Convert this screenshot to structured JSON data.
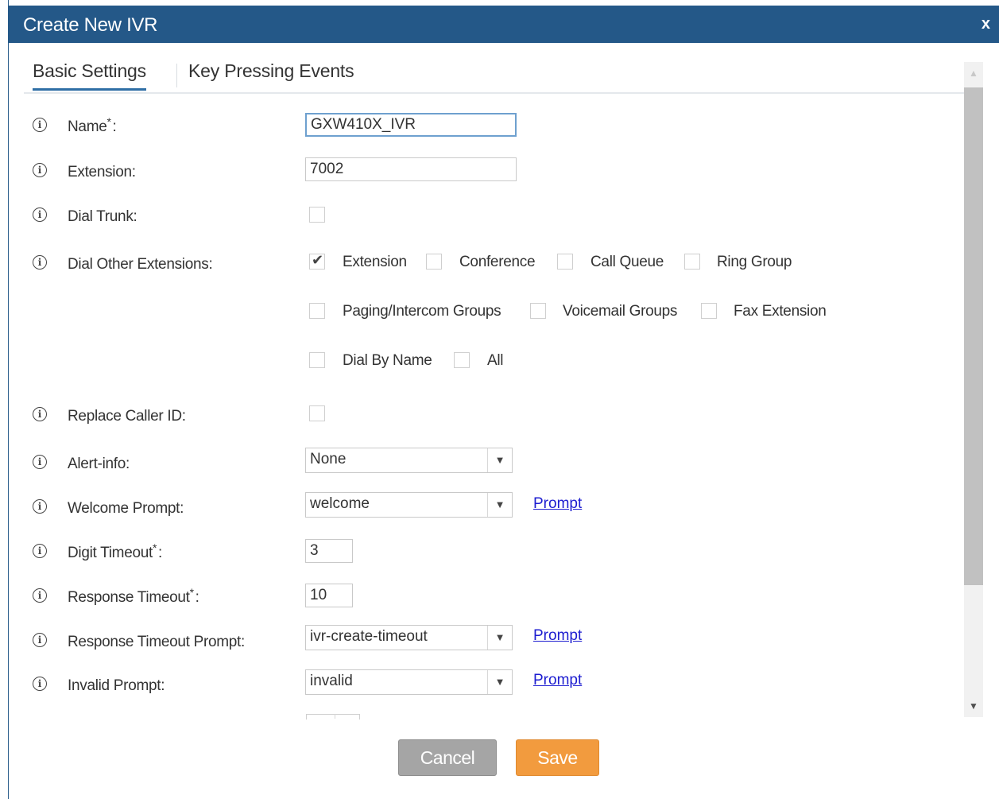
{
  "dialog": {
    "title": "Create New IVR",
    "close": "x"
  },
  "tabs": [
    "Basic Settings",
    "Key Pressing Events"
  ],
  "fields": {
    "name": {
      "label": "Name",
      "required": "*",
      "suffix": ":",
      "value": "GXW410X_IVR"
    },
    "extension": {
      "label": "Extension:",
      "value": "7002"
    },
    "dial_trunk": {
      "label": "Dial Trunk:",
      "checked": false
    },
    "dial_other_extensions": {
      "label": "Dial Other Extensions:",
      "options": [
        {
          "label": "Extension",
          "checked": true
        },
        {
          "label": "Conference",
          "checked": false
        },
        {
          "label": "Call Queue",
          "checked": false
        },
        {
          "label": "Ring Group",
          "checked": false
        },
        {
          "label": "Paging/Intercom Groups",
          "checked": false
        },
        {
          "label": "Voicemail Groups",
          "checked": false
        },
        {
          "label": "Fax Extension",
          "checked": false
        },
        {
          "label": "Dial By Name",
          "checked": false
        },
        {
          "label": "All",
          "checked": false
        }
      ]
    },
    "replace_caller_id": {
      "label": "Replace Caller ID:",
      "checked": false
    },
    "alert_info": {
      "label": "Alert-info:",
      "value": "None"
    },
    "welcome_prompt": {
      "label": "Welcome Prompt:",
      "value": "welcome",
      "link": "Prompt"
    },
    "digit_timeout": {
      "label": "Digit Timeout",
      "required": "*",
      "suffix": ":",
      "value": "3"
    },
    "response_timeout": {
      "label": "Response Timeout",
      "required": "*",
      "suffix": ":",
      "value": "10"
    },
    "response_timeout_prompt": {
      "label": "Response Timeout Prompt:",
      "value": "ivr-create-timeout",
      "link": "Prompt"
    },
    "invalid_prompt": {
      "label": "Invalid Prompt:",
      "value": "invalid",
      "link": "Prompt"
    }
  },
  "icons": {
    "info": "i",
    "dropdown": "▼",
    "scroll_up": "▲",
    "scroll_down": "▼",
    "check": "✔"
  },
  "buttons": {
    "cancel": "Cancel",
    "save": "Save"
  },
  "colors": {
    "titlebar": "#245888",
    "save": "#f29b3e",
    "cancel": "#a5a5a5",
    "link": "#1d1dd0"
  }
}
